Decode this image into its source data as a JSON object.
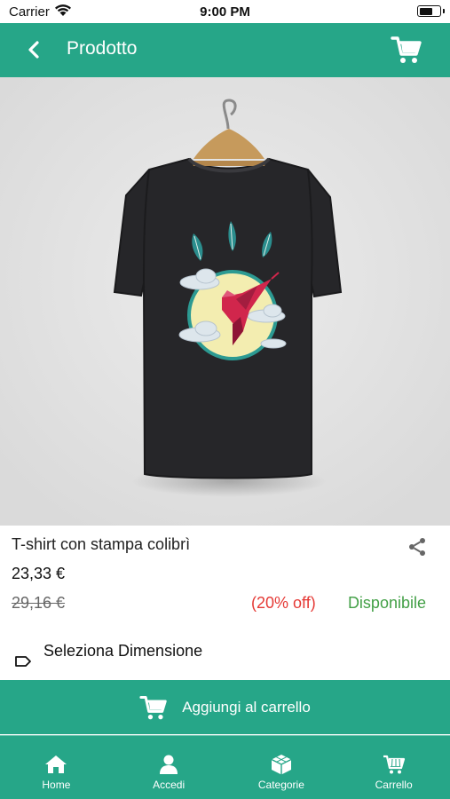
{
  "status_bar": {
    "carrier": "Carrier",
    "time": "9:00 PM",
    "battery_level": 0.7
  },
  "header": {
    "title": "Prodotto",
    "back_icon": "chevron-left-icon",
    "cart_icon": "shopping-cart-icon"
  },
  "product": {
    "image": "black-tshirt-hummingbird-print",
    "name": "T-shirt con stampa colibrì",
    "price": "23,33 €",
    "original_price": "29,16 €",
    "discount": "(20% off)",
    "availability": "Disponibile",
    "size_label": "Seleziona Dimensione",
    "share_icon": "share-icon"
  },
  "add_to_cart": {
    "label": "Aggiungi al carrello",
    "icon": "shopping-cart-icon"
  },
  "tabs": [
    {
      "label": "Home",
      "icon": "home-icon"
    },
    {
      "label": "Accedi",
      "icon": "user-icon"
    },
    {
      "label": "Categorie",
      "icon": "cube-icon"
    },
    {
      "label": "Carrello",
      "icon": "cart-icon"
    }
  ],
  "colors": {
    "primary": "#26a688",
    "discount": "#e53935",
    "available": "#43a047",
    "image_bg": "#e3e3e3"
  }
}
